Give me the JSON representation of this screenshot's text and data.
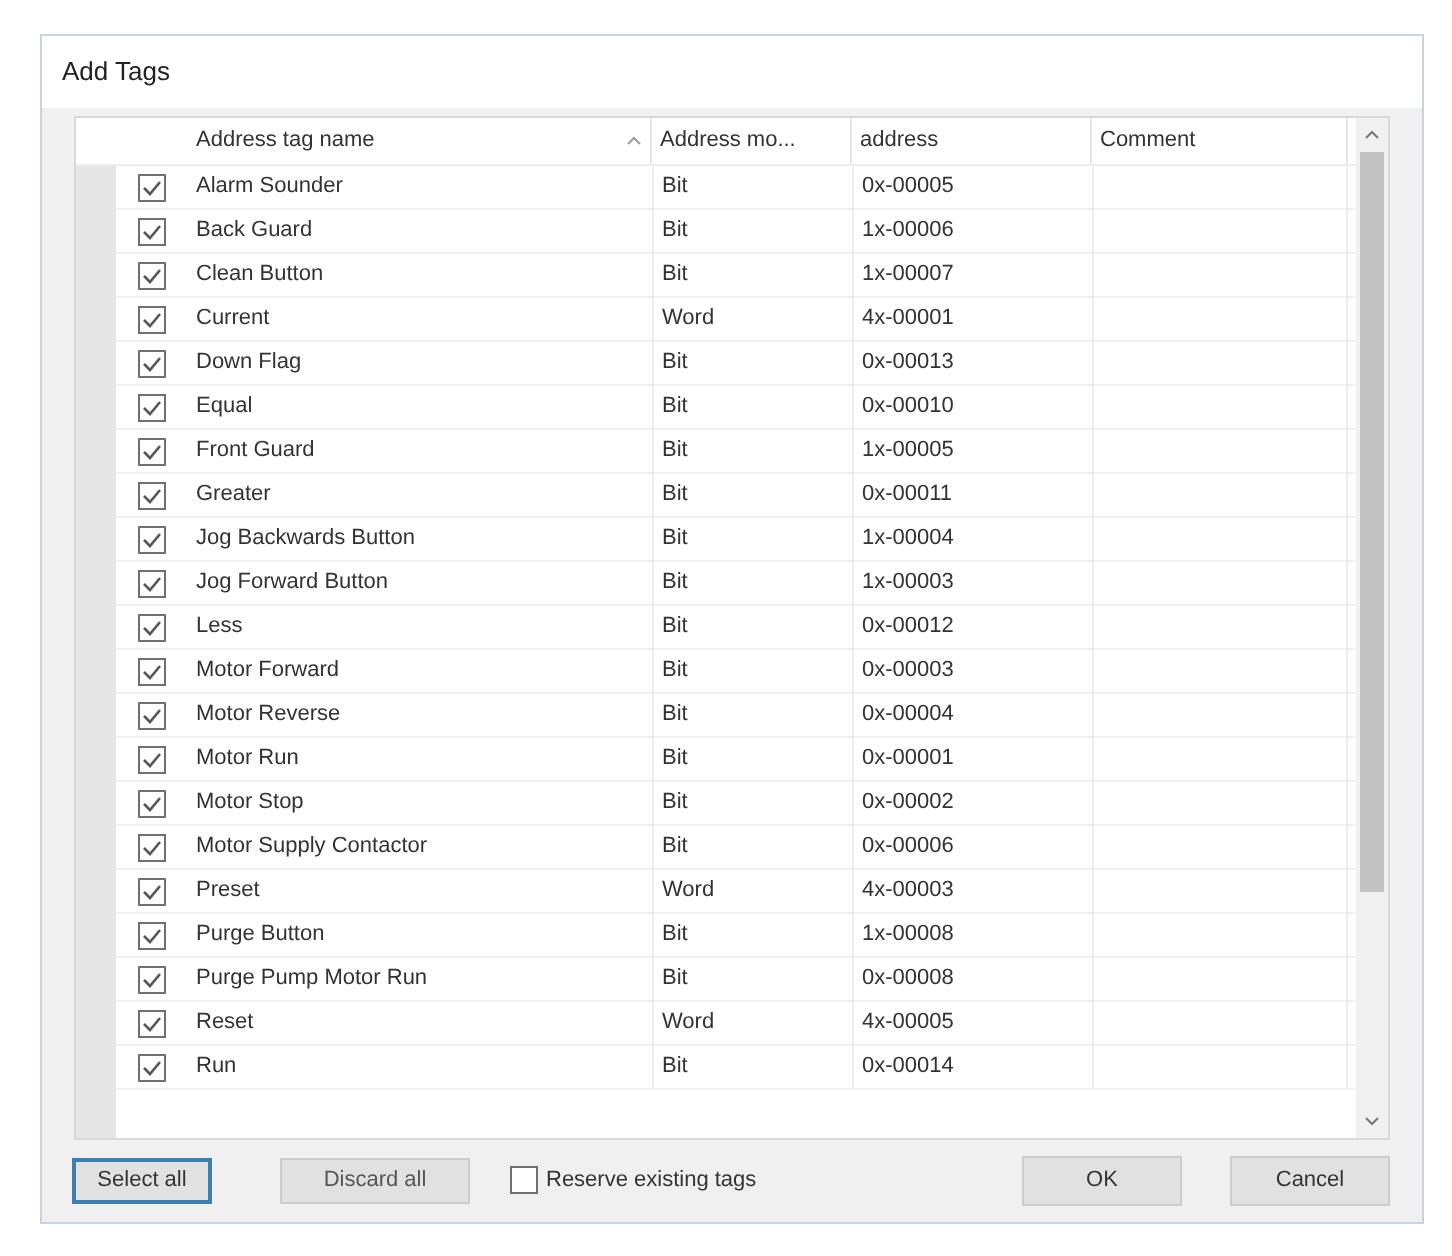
{
  "window": {
    "title": "Add Tags"
  },
  "table": {
    "columns": [
      {
        "label": "Address tag name",
        "sorted": true
      },
      {
        "label": "Address mo..."
      },
      {
        "label": "address"
      },
      {
        "label": "Comment"
      }
    ],
    "rows": [
      {
        "checked": true,
        "name": "Alarm Sounder",
        "mode": "Bit",
        "address": "0x-00005"
      },
      {
        "checked": true,
        "name": "Back Guard",
        "mode": "Bit",
        "address": "1x-00006"
      },
      {
        "checked": true,
        "name": "Clean Button",
        "mode": "Bit",
        "address": "1x-00007"
      },
      {
        "checked": true,
        "name": "Current",
        "mode": "Word",
        "address": "4x-00001"
      },
      {
        "checked": true,
        "name": "Down Flag",
        "mode": "Bit",
        "address": "0x-00013"
      },
      {
        "checked": true,
        "name": "Equal",
        "mode": "Bit",
        "address": "0x-00010"
      },
      {
        "checked": true,
        "name": "Front Guard",
        "mode": "Bit",
        "address": "1x-00005"
      },
      {
        "checked": true,
        "name": "Greater",
        "mode": "Bit",
        "address": "0x-00011"
      },
      {
        "checked": true,
        "name": "Jog Backwards Button",
        "mode": "Bit",
        "address": "1x-00004"
      },
      {
        "checked": true,
        "name": "Jog Forward Button",
        "mode": "Bit",
        "address": "1x-00003"
      },
      {
        "checked": true,
        "name": "Less",
        "mode": "Bit",
        "address": "0x-00012"
      },
      {
        "checked": true,
        "name": "Motor Forward",
        "mode": "Bit",
        "address": "0x-00003"
      },
      {
        "checked": true,
        "name": "Motor Reverse",
        "mode": "Bit",
        "address": "0x-00004"
      },
      {
        "checked": true,
        "name": "Motor Run",
        "mode": "Bit",
        "address": "0x-00001"
      },
      {
        "checked": true,
        "name": "Motor Stop",
        "mode": "Bit",
        "address": "0x-00002"
      },
      {
        "checked": true,
        "name": "Motor Supply Contactor",
        "mode": "Bit",
        "address": "0x-00006"
      },
      {
        "checked": true,
        "name": "Preset",
        "mode": "Word",
        "address": "4x-00003"
      },
      {
        "checked": true,
        "name": "Purge Button",
        "mode": "Bit",
        "address": "1x-00008"
      },
      {
        "checked": true,
        "name": "Purge Pump Motor Run",
        "mode": "Bit",
        "address": "0x-00008"
      },
      {
        "checked": true,
        "name": "Reset",
        "mode": "Word",
        "address": "4x-00005"
      },
      {
        "checked": true,
        "name": "Run",
        "mode": "Bit",
        "address": "0x-00014"
      }
    ]
  },
  "buttons": {
    "select_all": "Select all",
    "discard_all": "Discard all",
    "reserve": {
      "label": "Reserve existing tags",
      "checked": false
    },
    "ok": "OK",
    "cancel": "Cancel"
  }
}
